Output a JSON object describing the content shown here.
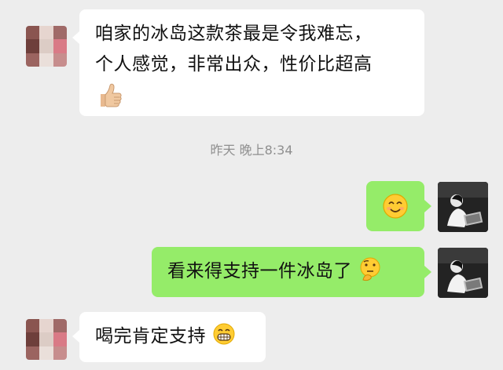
{
  "messages": [
    {
      "side": "left",
      "lines": [
        "咱家的冰岛这款茶最是令我难忘，",
        "个人感觉，非常出众，性价比超高"
      ],
      "emoji": "thumbs-up-emoji"
    },
    {
      "side": "right",
      "text": "",
      "emoji": "smiling-face-emoji"
    },
    {
      "side": "right",
      "text": "看来得支持一件冰岛了",
      "emoji": "thinking-face-emoji"
    },
    {
      "side": "left",
      "text": "喝完肯定支持",
      "emoji": "grinning-face-emoji"
    }
  ],
  "timestamp": "昨天 晚上8:34",
  "colors": {
    "background": "#ededed",
    "incoming_bubble": "#ffffff",
    "outgoing_bubble": "#95ec69",
    "timestamp_text": "#8f8f8f"
  },
  "icons": [
    "thumbs-up-emoji",
    "smiling-face-emoji",
    "thinking-face-emoji",
    "grinning-face-emoji"
  ]
}
